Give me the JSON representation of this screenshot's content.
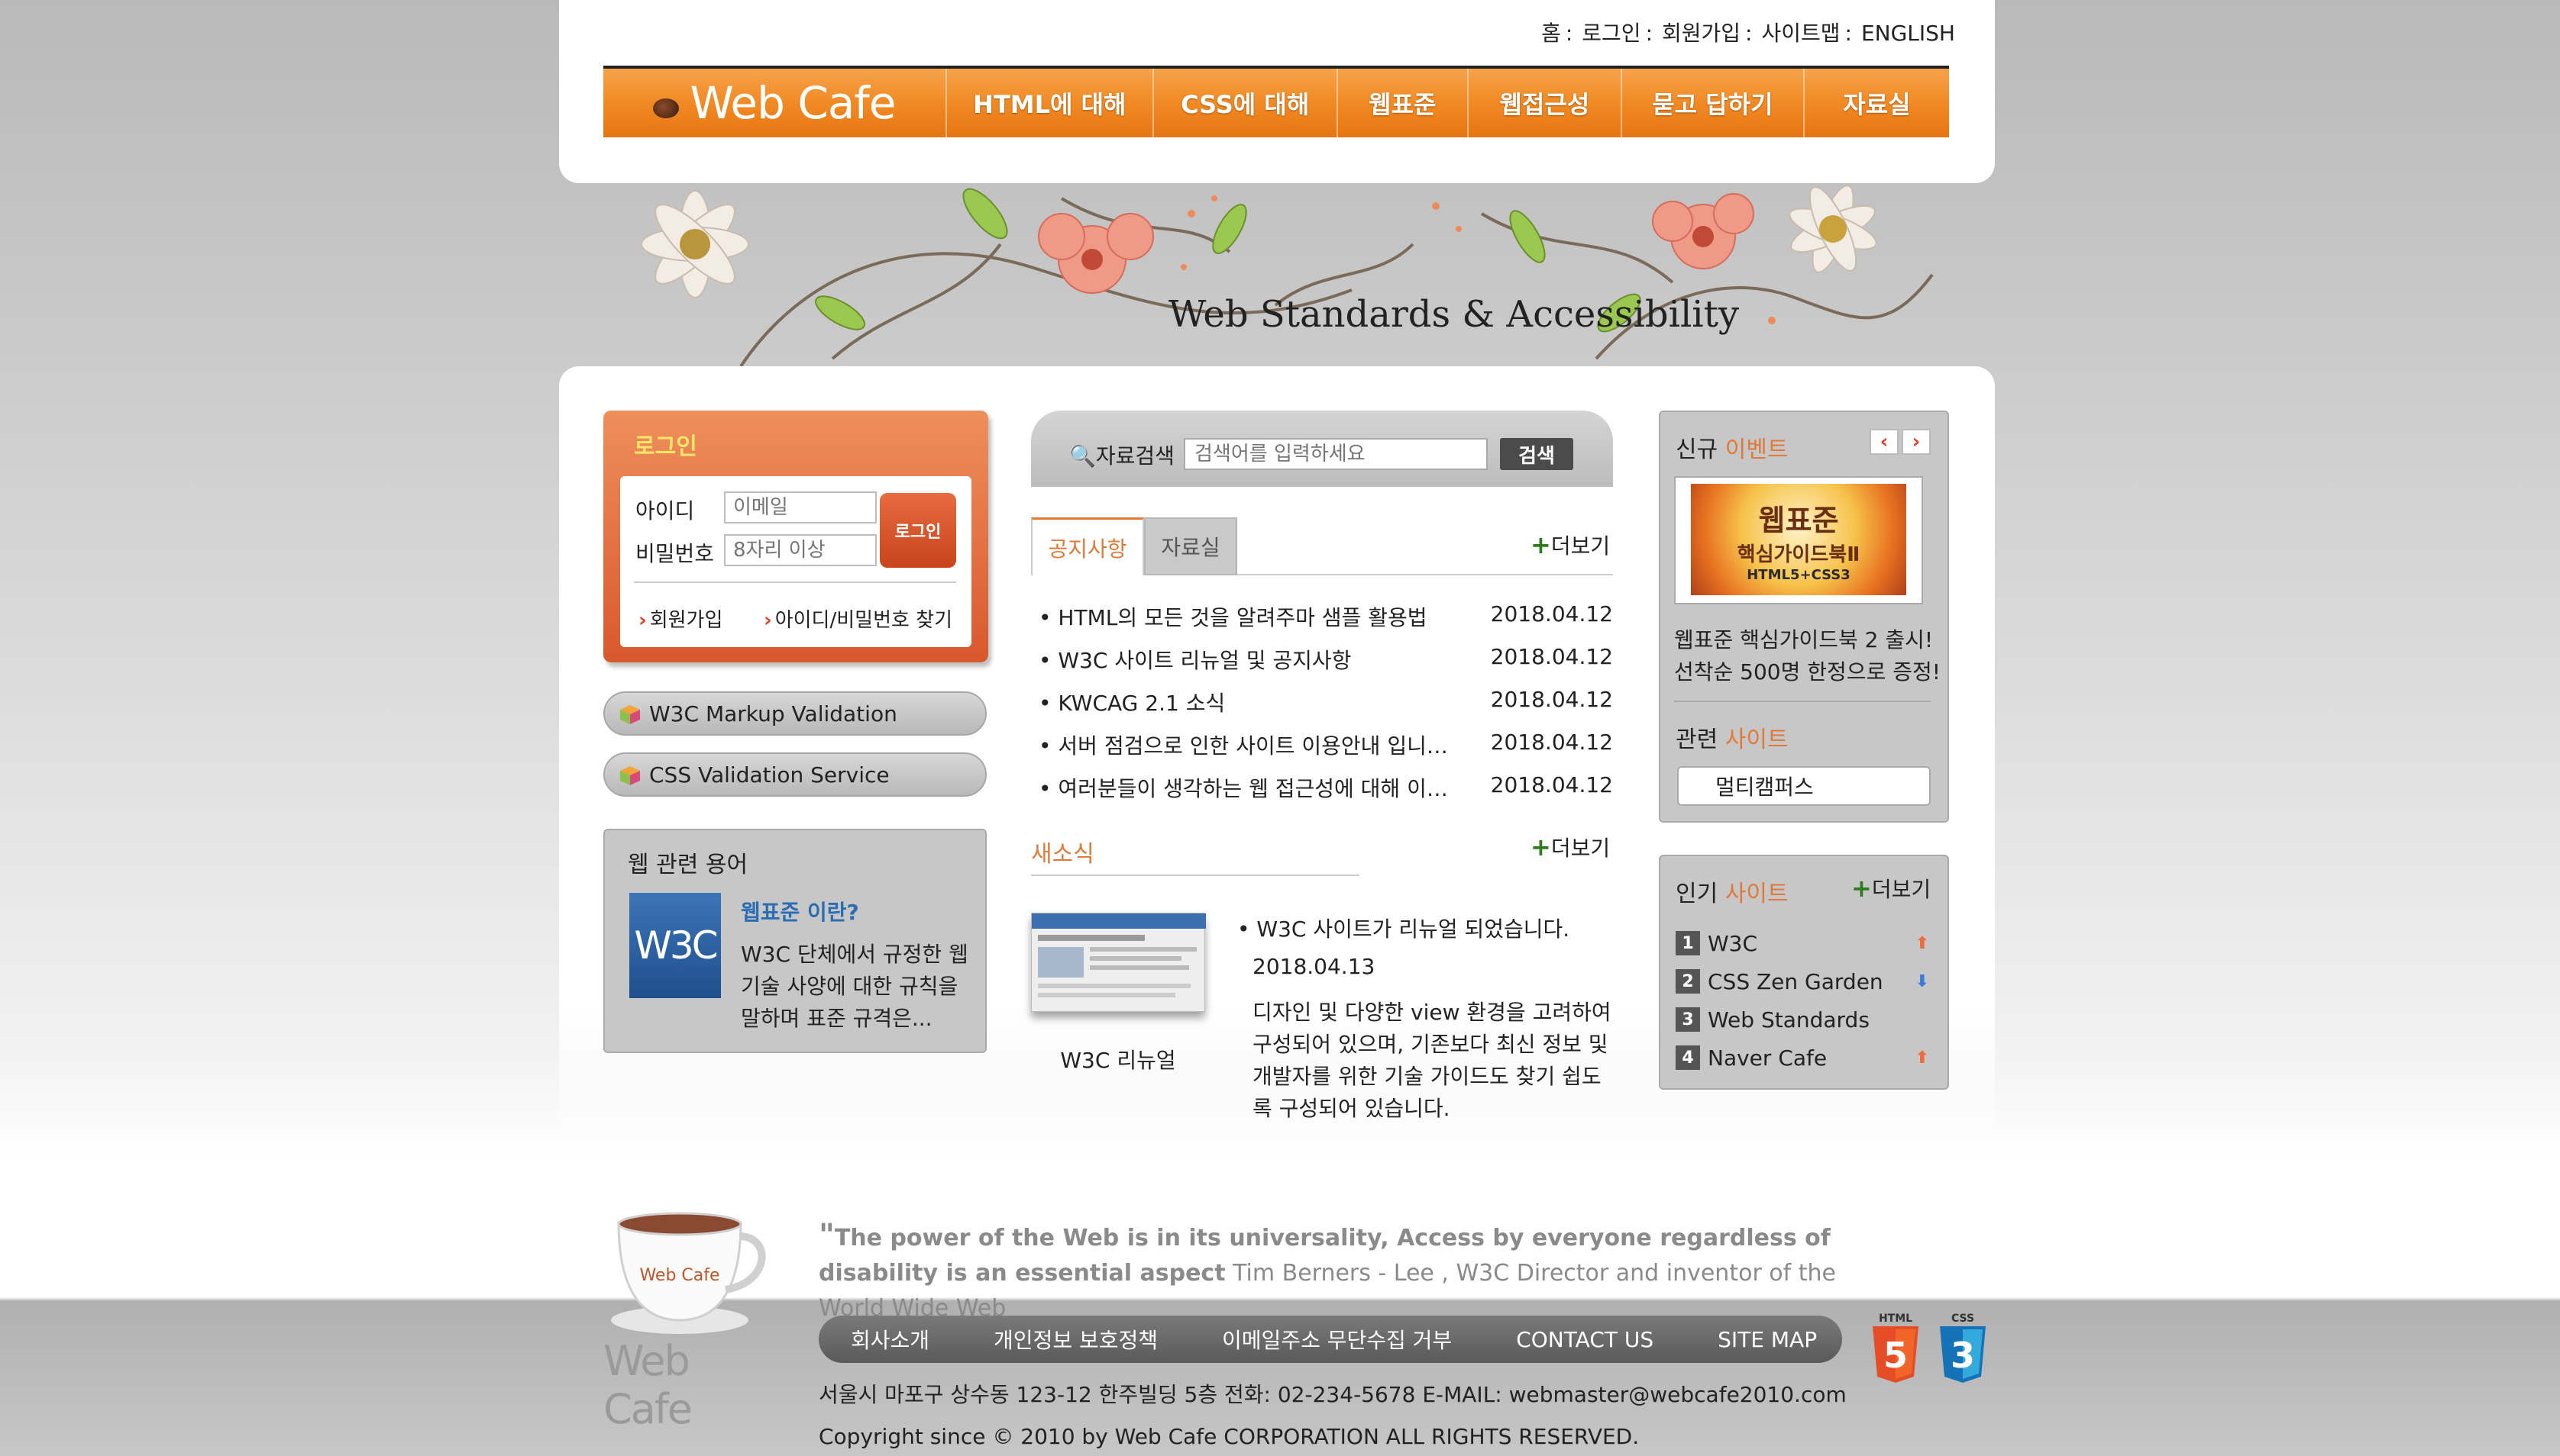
{
  "util_nav": {
    "items": [
      "홈",
      "로그인",
      "회원가입",
      "사이트맵",
      "ENGLISH"
    ]
  },
  "gnb": {
    "logo": "Web Cafe",
    "items": [
      "HTML에 대해",
      "CSS에 대해",
      "웹표준",
      "웹접근성",
      "묻고 답하기",
      "자료실"
    ]
  },
  "banner": {
    "tagline": "Web Standards & Accessibility"
  },
  "login": {
    "title": "로그인",
    "id_label": "아이디",
    "id_placeholder": "이메일",
    "pw_label": "비밀번호",
    "pw_placeholder": "8자리 이상",
    "button": "로그인",
    "join_link": "회원가입",
    "find_link": "아이디/비밀번호 찾기"
  },
  "validation": {
    "markup": "W3C Markup Validation",
    "css": "CSS Validation Service"
  },
  "terms": {
    "title": "웹 관련 용어",
    "logo": "W3C",
    "subtitle": "웹표준 이란?",
    "desc": "W3C 단체에서 규정한 웹 기술 사양에 대한 규칙을 말하며 표준 규격은..."
  },
  "search": {
    "label": "자료검색",
    "placeholder": "검색어를 입력하세요",
    "button": "검색"
  },
  "board": {
    "tabs": [
      "공지사항",
      "자료실"
    ],
    "more": "더보기",
    "items": [
      {
        "title": "HTML의 모든 것을 알려주마 샘플 활용법",
        "date": "2018.04.12"
      },
      {
        "title": "W3C 사이트 리뉴얼 및 공지사항",
        "date": "2018.04.12"
      },
      {
        "title": "KWCAG 2.1 소식",
        "date": "2018.04.12"
      },
      {
        "title": "서버 점검으로 인한 사이트 이용안내 입니다.",
        "date": "2018.04.12"
      },
      {
        "title": "여러분들이 생각하는 웹 접근성에 대해 이야…",
        "date": "2018.04.12"
      }
    ]
  },
  "news": {
    "title": "새소식",
    "more": "더보기",
    "thumb_caption": "W3C 리뉴얼",
    "headline": "W3C 사이트가 리뉴얼 되었습니다.",
    "date": "2018.04.13",
    "body": "디자인 및 다양한 view 환경을 고려하여 구성되어 있으며, 기존보다 최신 정보 및 개발자를 위한 기술 가이드도 찾기 쉽도록 구성되어 있습니다."
  },
  "event": {
    "title_a": "신규",
    "title_b": "이벤트",
    "prev": "‹",
    "next": "›",
    "book_title": "웹표준",
    "book_sub": "핵심가이드북Ⅱ",
    "book_tag": "HTML5+CSS3",
    "text_1": "웹표준 핵심가이드북 2 출시!",
    "text_2": "선착순 500명 한정으로 증정!"
  },
  "related": {
    "title_a": "관련",
    "title_b": "사이트",
    "selected": "멀티캠퍼스"
  },
  "popular": {
    "title_a": "인기",
    "title_b": "사이트",
    "more": "더보기",
    "items": [
      {
        "rank": "1",
        "name": "W3C",
        "trend": "up"
      },
      {
        "rank": "2",
        "name": "CSS Zen Garden",
        "trend": "down"
      },
      {
        "rank": "3",
        "name": "Web Standards",
        "trend": "none"
      },
      {
        "rank": "4",
        "name": "Naver Cafe",
        "trend": "up"
      }
    ]
  },
  "footer": {
    "cup_label": "Web Cafe",
    "logo": "Web Cafe",
    "quote_bold": "The power of the Web is in its universality, Access by everyone regardless of disability is an essential aspect",
    "quote_author": "Tim Berners - Lee , W3C Director and inventor of the World Wide Web",
    "nav": [
      "회사소개",
      "개인정보 보호정책",
      "이메일주소 무단수집 거부",
      "CONTACT US",
      "SITE MAP"
    ],
    "address": "서울시 마포구 상수동 123-12 한주빌딩 5층   전화: 02-234-5678   E-MAIL: webmaster@webcafe2010.com",
    "copyright": "Copyright since © 2010 by Web Cafe CORPORATION ALL RIGHTS RESERVED.",
    "html5_label": "HTML",
    "html5_num": "5",
    "css3_label": "CSS",
    "css3_num": "3"
  },
  "colors": {
    "brand_orange": "#f18a24",
    "accent": "#e07a3a",
    "login_red": "#d8582c",
    "link_blue": "#2a6db3"
  }
}
